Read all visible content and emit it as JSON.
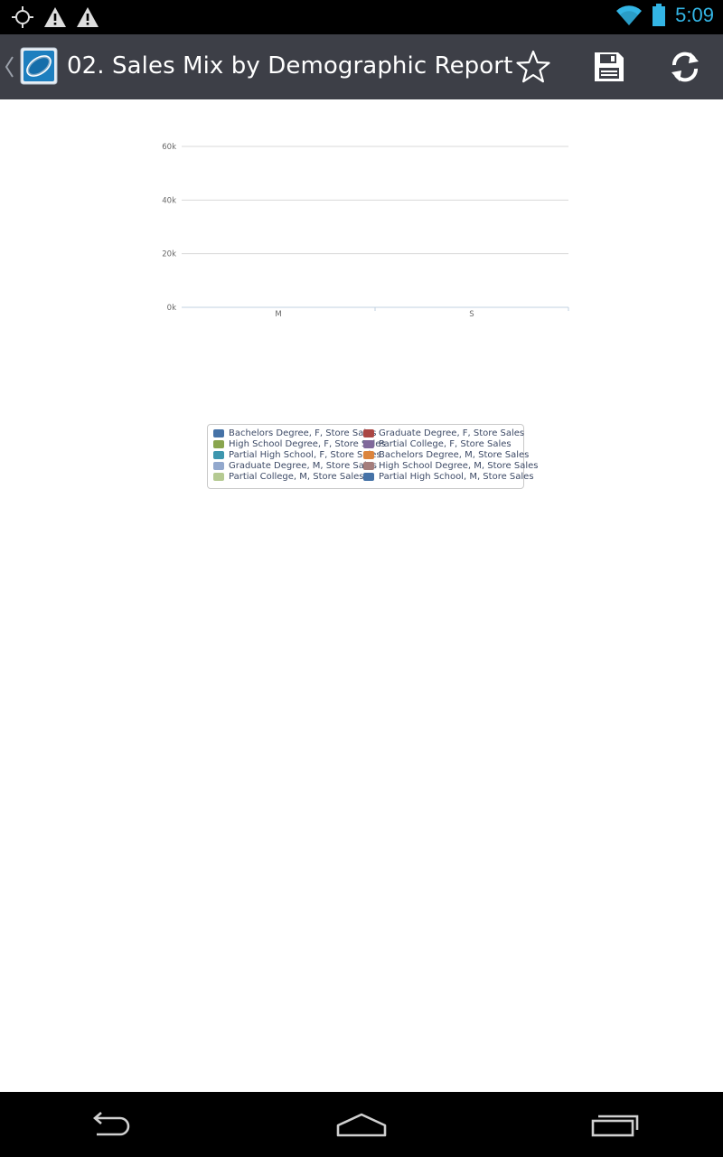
{
  "status_bar": {
    "left_icons": [
      "gps-icon",
      "warning-icon",
      "warning-icon"
    ],
    "right_icons": [
      "wifi-icon",
      "battery-icon"
    ],
    "time": "5:09",
    "accent_color": "#33b5e5"
  },
  "action_bar": {
    "title": "02. Sales Mix by Demographic Report",
    "actions": [
      "star-icon",
      "save-icon",
      "refresh-icon"
    ]
  },
  "chart_data": {
    "type": "bar",
    "categories": [
      "M",
      "S"
    ],
    "ylim": [
      0,
      60000
    ],
    "y_ticks": [
      "0k",
      "20k",
      "40k",
      "60k"
    ],
    "grid": true,
    "legend_position": "bottom",
    "series": [
      {
        "name": "Bachelors Degree, F, Store Sales",
        "color": "#4572a7",
        "values": [
          0,
          0
        ]
      },
      {
        "name": "Graduate Degree, F, Store Sales",
        "color": "#aa4643",
        "values": [
          0,
          0
        ]
      },
      {
        "name": "High School Degree, F, Store Sales",
        "color": "#89a54e",
        "values": [
          0,
          0
        ]
      },
      {
        "name": "Partial College, F, Store Sales",
        "color": "#80699b",
        "values": [
          0,
          0
        ]
      },
      {
        "name": "Partial High School, F, Store Sales",
        "color": "#3d96ae",
        "values": [
          0,
          0
        ]
      },
      {
        "name": "Bachelors Degree, M, Store Sales",
        "color": "#db843d",
        "values": [
          0,
          0
        ]
      },
      {
        "name": "Graduate Degree, M, Store Sales",
        "color": "#92a8cd",
        "values": [
          0,
          0
        ]
      },
      {
        "name": "High School Degree, M, Store Sales",
        "color": "#a47d7c",
        "values": [
          0,
          0
        ]
      },
      {
        "name": "Partial College, M, Store Sales",
        "color": "#b5ca92",
        "values": [
          0,
          0
        ]
      },
      {
        "name": "Partial High School, M, Store Sales",
        "color": "#4572a7",
        "values": [
          0,
          0
        ]
      }
    ]
  },
  "nav_bar": {
    "buttons": [
      "back-icon",
      "home-icon",
      "recents-icon"
    ]
  }
}
